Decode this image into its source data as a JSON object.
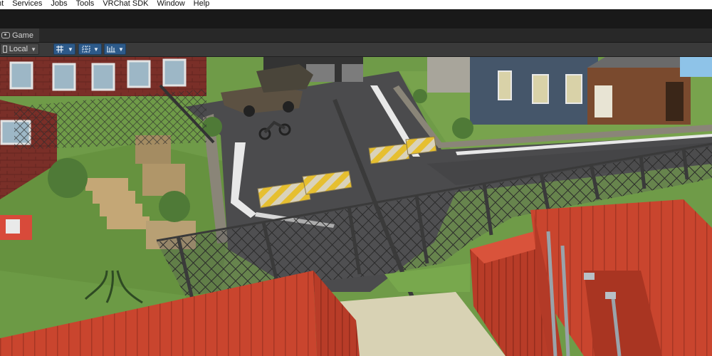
{
  "menu": [
    "nt",
    "Services",
    "Jobs",
    "Tools",
    "VRChat SDK",
    "Window",
    "Help"
  ],
  "game_tab": {
    "label": "Game",
    "icon": "gamepad-icon"
  },
  "scene_toolbar": {
    "pivot_space": {
      "label": "Local",
      "icon": "local-space-icon"
    },
    "buttons": [
      {
        "icon": "grid-snap-icon"
      },
      {
        "icon": "grid-visibility-icon"
      },
      {
        "icon": "increment-snap-icon"
      }
    ]
  },
  "colors": {
    "menubar": "#ffffff",
    "editor_bg": "#191919",
    "tab_active": "#383838",
    "toolbar_button_active": "#2d5a8a",
    "container_red": "#c9452e",
    "road": "#4a4a4c",
    "grass": "#6d9a47",
    "barrier_yellow": "#e9c12e"
  }
}
